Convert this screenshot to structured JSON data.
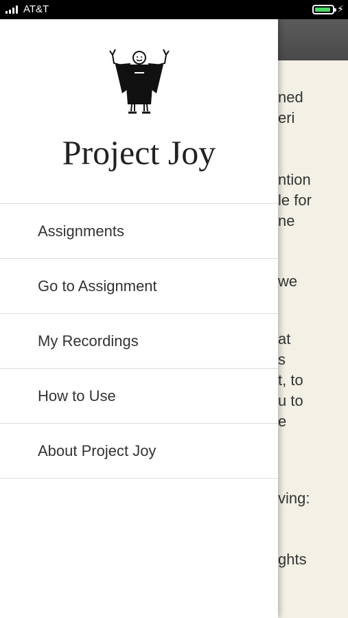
{
  "status_bar": {
    "carrier": "AT&T"
  },
  "drawer": {
    "app_title": "Project Joy",
    "menu": [
      {
        "label": "Assignments"
      },
      {
        "label": "Go to Assignment"
      },
      {
        "label": "My Recordings"
      },
      {
        "label": "How to Use"
      },
      {
        "label": "About Project Joy"
      }
    ]
  },
  "background_content": {
    "fragments": [
      "ned",
      "eri",
      "ntion",
      "le for",
      "ne",
      "we",
      "at",
      "s",
      "t, to",
      "u to",
      "e",
      "ving:",
      "ghts"
    ]
  },
  "colors": {
    "status_bar": "#000000",
    "battery": "#4cd964",
    "header": "#4a4a4a",
    "background": "#f3f0e5"
  }
}
